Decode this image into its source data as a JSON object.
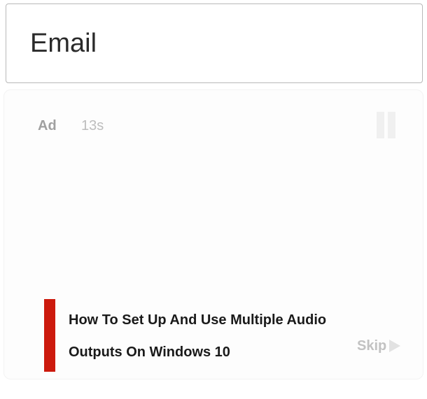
{
  "email_field": {
    "placeholder": "Email"
  },
  "ad": {
    "badge": "Ad",
    "timer": "13s",
    "title": "How To Set Up And Use Multiple Audio Outputs On Windows 10",
    "skip_label": "Skip",
    "accent_color": "#cc1a0d",
    "icons": {
      "pause": "pause-icon",
      "skip": "play-arrow-icon"
    }
  }
}
